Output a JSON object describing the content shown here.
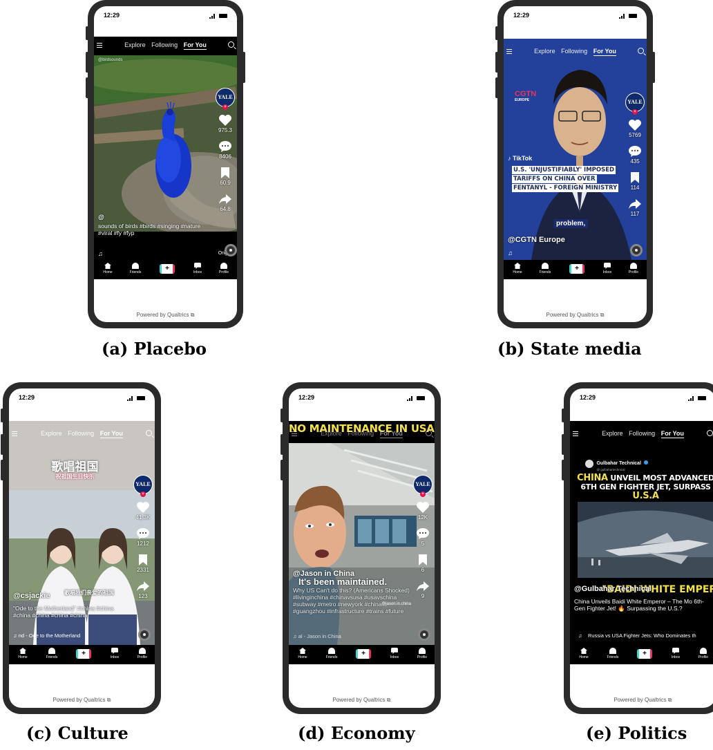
{
  "status_time": "12:29",
  "nav_tabs": [
    "Explore",
    "Following",
    "For You"
  ],
  "bottom_nav": {
    "home": "Home",
    "friends": "Friends",
    "inbox": "Inbox",
    "profile": "Profile",
    "create": "+"
  },
  "powered_by": "Powered by Qualtrics",
  "panels": {
    "a": {
      "label": "(a) Placebo",
      "avatar": "YALE",
      "likes": "975.3",
      "comments": "8406",
      "saves": "60.9",
      "shares": "64.8",
      "username": "@",
      "caption": "sounds of birds #birds #singing #nature #viral #fy #fyp",
      "music": "Orig",
      "watermark": "@birdsounds"
    },
    "b": {
      "label": "(b) State media",
      "avatar": "YALE",
      "likes": "5769",
      "comments": "435",
      "saves": "114",
      "shares": "117",
      "username": "@CGTN Europe",
      "logo": "CGTN",
      "logo_sub": "EUROPE",
      "tiktok": "TikTok",
      "headline": "U.S. 'UNJUSTIFIABLY' IMPOSED TARIFFS ON CHINA OVER FENTANYL - FOREIGN MINISTRY",
      "subtitle": "problem,"
    },
    "c": {
      "label": "(c) Culture",
      "avatar": "YALE",
      "likes": "41.3K",
      "comments": "1212",
      "saves": "2331",
      "shares": "123",
      "username": "@csjackie",
      "title_cn": "歌唱祖国",
      "subtitle_cn": "祝祖国生日快乐",
      "overlay_cn": "歌唱我们亲爱的祖国",
      "caption": "\"Ode to the Motherland\" #china #china #china #china #china #china",
      "music": "nd - Ode to the Motherland"
    },
    "d": {
      "label": "(d) Economy",
      "avatar": "YALE",
      "likes": "12K",
      "comments": "5",
      "saves": "6",
      "shares": "9",
      "headline": "NO MAINTENANCE IN USA?",
      "username": "@Jason in China",
      "subtitle": "It's been maintained.",
      "caption": "Why US Can't do this? (Americans Shocked) #livinginchina #chinavsusa #usavschina #subway #metro #newyork #china #guangzhou #infrastructure #trains #future",
      "music": "al - Jason in China",
      "watermark": "@jason.in.china"
    },
    "e": {
      "label": "(e) Politics",
      "channel": "Gulbahar Technical",
      "channel_handle": "@ gulbahartechnical",
      "headline_pre": "CHINA",
      "headline_mid": " UNVEIL MOST ADVANCED 6TH GEN FIGHTER JET, SURPASS ",
      "headline_post": "U.S.A",
      "username": "@Gulbahar Technical",
      "overlay": "\"BAIDI WHITE EMPEROR\"",
      "caption": "China Unveils Baidi White Emperor – The Mo 6th-Gen Fighter Jet! 🔥 Surpassing the U.S.?",
      "music": "Russia vs USA Fighter Jets: Who Dominates th"
    }
  },
  "colors": {
    "bezel": "#2b2b2b",
    "tiktok_cyan": "#41d7d1",
    "tiktok_red": "#e8345a",
    "yale_blue": "#0f2a6b",
    "headline_yellow": "#f3e04a"
  }
}
